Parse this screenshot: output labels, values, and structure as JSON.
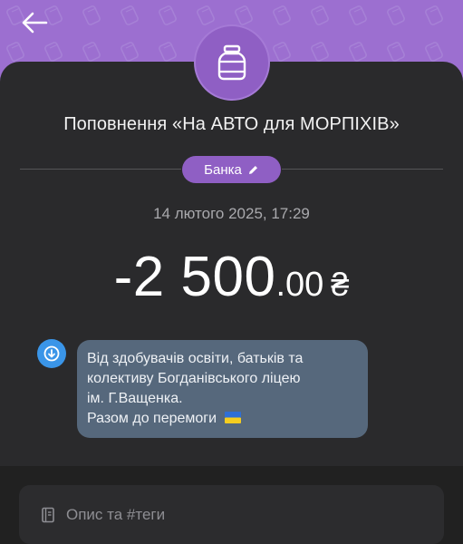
{
  "header": {
    "back_icon": "arrow-left-icon",
    "accent_color": "#9c6fd0"
  },
  "jar": {
    "icon": "jar-icon"
  },
  "transaction": {
    "title": "Поповнення «На АВТО для МОРПІХІВ»",
    "category": "Банка",
    "category_edit_icon": "pencil-icon",
    "date": "14 лютого 2025, 17:29",
    "amount_main": "-2 500",
    "amount_cents": ".00",
    "currency": "₴"
  },
  "comment": {
    "avatar_icon": "arrow-down-circle-icon",
    "lines": [
      "Від здобувачів освіти, батьків та",
      "колективу Богданівського ліцею",
      "ім. Г.Ващенка.",
      "Разом до перемоги"
    ],
    "flag_icon": "ukraine-flag-icon"
  },
  "description": {
    "placeholder": "Опис та #теги",
    "icon": "note-icon"
  }
}
